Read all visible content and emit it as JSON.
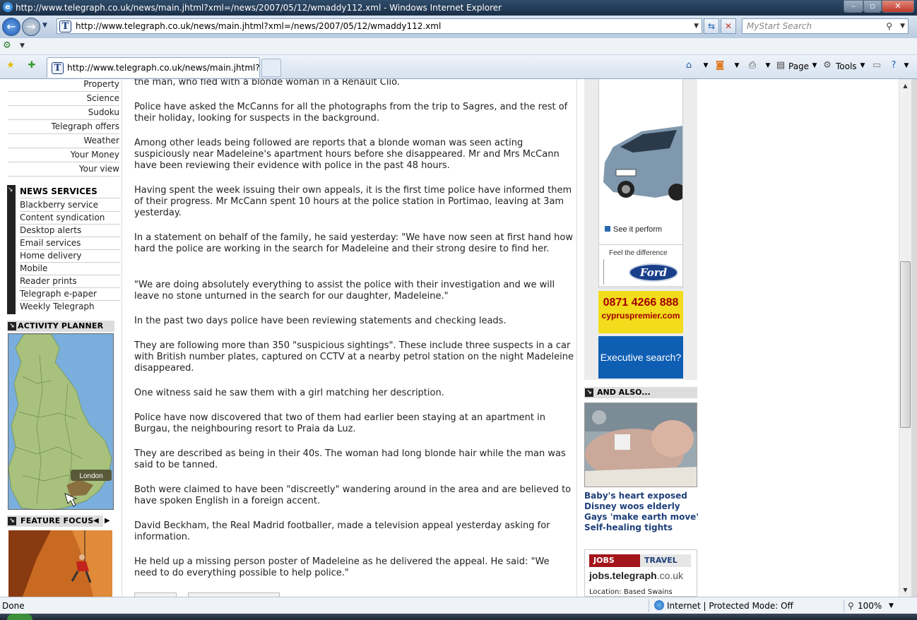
{
  "window": {
    "title": "http://www.telegraph.co.uk/news/main.jhtml?xml=/news/2007/05/12/wmaddy112.xml - Windows Internet Explorer",
    "controls": [
      "–",
      "▫",
      "✕"
    ]
  },
  "navigation": {
    "address": "http://www.telegraph.co.uk/news/main.jhtml?xml=/news/2007/05/12/wmaddy112.xml",
    "search_placeholder": "MyStart Search"
  },
  "tab": {
    "title": "http://www.telegraph.co.uk/news/main.jhtml?x..."
  },
  "toolbar": {
    "page_label": "Page",
    "tools_label": "Tools"
  },
  "leftnav": {
    "links": [
      "Property",
      "Science",
      "Sudoku",
      "Telegraph offers",
      "Weather",
      "Your Money",
      "Your view"
    ],
    "news_services_title": "NEWS SERVICES",
    "news_services": [
      "Blackberry service",
      "Content syndication",
      "Desktop alerts",
      "Email services",
      "Home delivery",
      "Mobile",
      "Reader prints",
      "Telegraph e-paper",
      "Weekly Telegraph"
    ],
    "activity_planner_title": "ACTIVITY PLANNER",
    "map_label": "London",
    "feature_focus_title": "FEATURE FOCUS"
  },
  "article": {
    "paragraphs": [
      "the man, who fled with a blonde woman in a Renault Clio.",
      "Police have asked the McCanns for all the photographs from the trip to Sagres, and the rest of their holiday, looking for suspects in the background.",
      "Among other leads being followed are reports that a blonde woman was seen acting suspiciously near Madeleine's apartment hours before she disappeared. Mr and Mrs McCann have been reviewing their evidence with police in the past 48 hours.",
      "Having spent the week issuing their own appeals, it is the first time police have informed them of their progress. Mr McCann spent 10 hours at the police station in Portimao, leaving at 3am yesterday.",
      "In a statement on behalf of the family, he said yesterday: \"We have now seen at first hand how hard the police are working in the search for Madeleine and their strong desire to find her.",
      "\"We are doing absolutely everything to assist the police with their investigation and we will leave no stone unturned in the search for our daughter, Madeleine.\"",
      "In the past two days police have been reviewing statements and checking leads.",
      "They are following more than 350 \"suspicious sightings\". These include three suspects in a car with British number plates, captured on CCTV at a nearby petrol station on the night Madeleine disappeared.",
      "One witness said he saw them with a girl matching her description.",
      "Police have now discovered that two of them had earlier been staying at an apartment in Burgau, the neighbouring resort to Praia da Luz.",
      "They are described as being in their 40s. The woman had long blonde hair while the man was said to be tanned.",
      "Both were claimed to have been \"discreetly\" wandering around in the area and are believed to have spoken English in a foreign accent.",
      "David Beckham, the Real Madrid footballer, made a television appeal yesterday asking for information.",
      "He held up a missing person poster of Madeleine as he delivered the appeal. He said: \"We need to do everything possible to help police.\""
    ]
  },
  "ads": {
    "car_link": "See it perform",
    "ford_tagline": "Feel the difference",
    "ford_logo": "Ford",
    "cyprus_phone": "0871 4266 888",
    "cyprus_site": "cypruspremier.com",
    "executive": "Executive search?"
  },
  "and_also": {
    "title": "AND ALSO...",
    "links": [
      "Baby's heart exposed",
      "Disney woos elderly",
      "Gays 'make earth move'",
      "Self-healing tights"
    ]
  },
  "jobs": {
    "tab_jobs": "JOBS",
    "tab_travel": "TRAVEL",
    "logo_bold": "jobs.telegraph",
    "logo_suffix": ".co.uk",
    "location": "Location: Based Swains"
  },
  "status": {
    "left": "Done",
    "zone": "Internet | Protected Mode: Off",
    "zoom": "100%"
  }
}
